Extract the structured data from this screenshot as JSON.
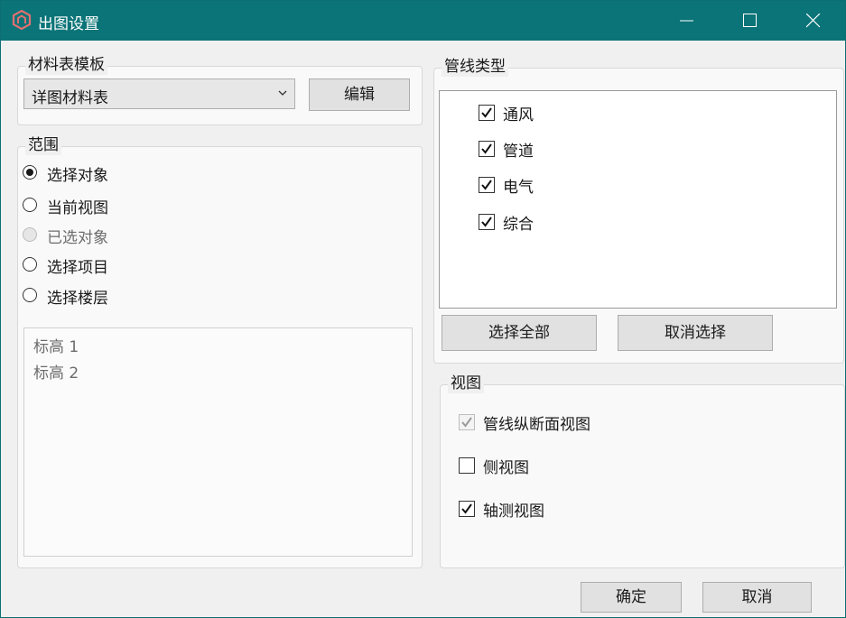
{
  "window": {
    "title": "出图设置",
    "accent_color": "#0b7478"
  },
  "material_template": {
    "legend": "材料表模板",
    "selected": "详图材料表",
    "edit_button": "编辑"
  },
  "scope": {
    "legend": "范围",
    "options": [
      {
        "label": "选择对象",
        "checked": true,
        "disabled": false
      },
      {
        "label": "当前视图",
        "checked": false,
        "disabled": false
      },
      {
        "label": "已选对象",
        "checked": false,
        "disabled": true
      },
      {
        "label": "选择项目",
        "checked": false,
        "disabled": false
      },
      {
        "label": "选择楼层",
        "checked": false,
        "disabled": false
      }
    ],
    "levels": [
      "标高 1",
      "标高 2"
    ]
  },
  "pipe_types": {
    "legend": "管线类型",
    "items": [
      {
        "label": "通风",
        "checked": true
      },
      {
        "label": "管道",
        "checked": true
      },
      {
        "label": "电气",
        "checked": true
      },
      {
        "label": "综合",
        "checked": true
      }
    ],
    "select_all_button": "选择全部",
    "deselect_button": "取消选择"
  },
  "views": {
    "legend": "视图",
    "items": [
      {
        "label": "管线纵断面视图",
        "checked": true,
        "disabled": true
      },
      {
        "label": "侧视图",
        "checked": false,
        "disabled": false
      },
      {
        "label": "轴测视图",
        "checked": true,
        "disabled": false
      }
    ]
  },
  "footer": {
    "ok_button": "确定",
    "cancel_button": "取消"
  }
}
